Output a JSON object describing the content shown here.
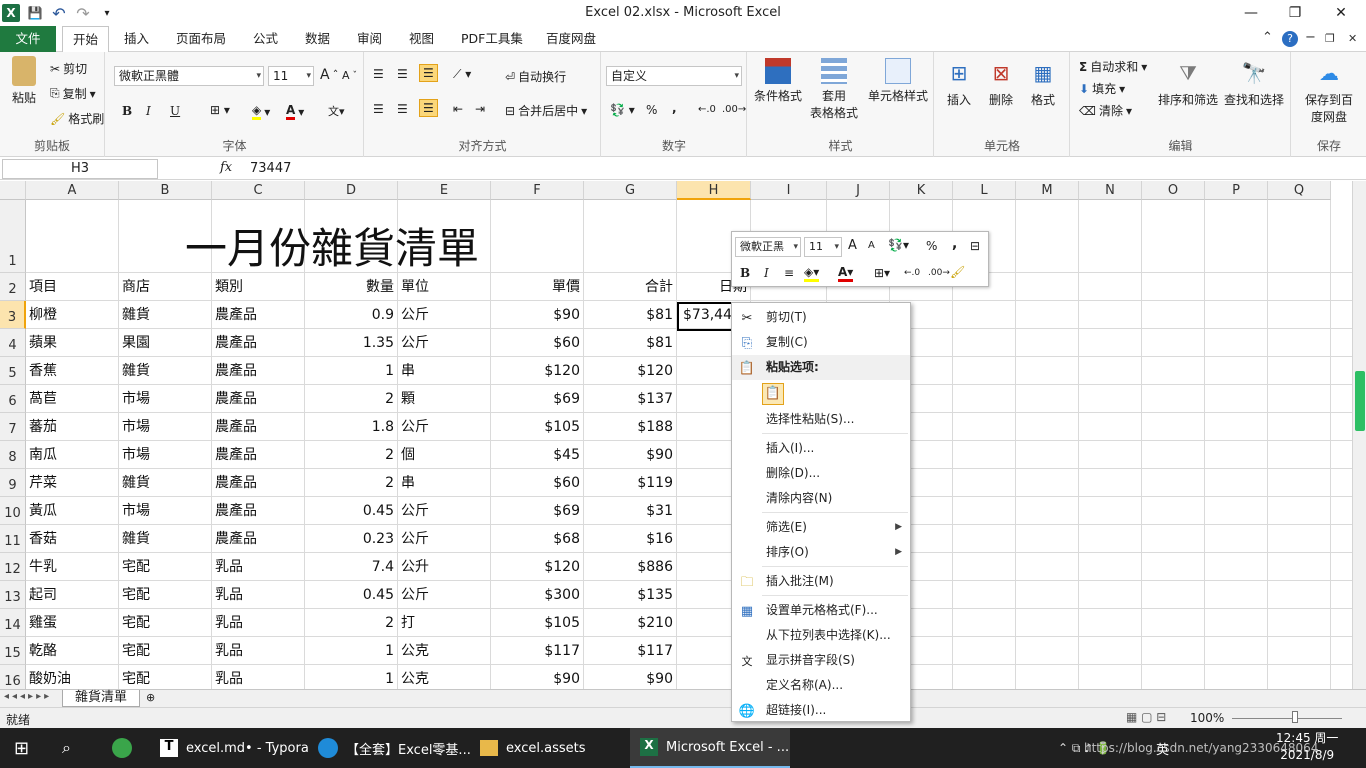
{
  "window": {
    "title": "Excel 02.xlsx  -  Microsoft Excel",
    "min": "—",
    "restore": "❐",
    "close": "✕"
  },
  "qat": {
    "logo": "X",
    "save": "💾",
    "undo": "↶",
    "redo": "↷",
    "custom": "▾"
  },
  "tabs": [
    "文件",
    "开始",
    "插入",
    "页面布局",
    "公式",
    "数据",
    "审阅",
    "视图",
    "PDF工具集",
    "百度网盘"
  ],
  "ribbon": {
    "clipboard": {
      "label": "剪贴板",
      "paste": "粘贴",
      "cut": "剪切",
      "copy": "复制",
      "painter": "格式刷"
    },
    "font": {
      "label": "字体",
      "name": "微軟正黑體",
      "size": "11",
      "bold": "B",
      "italic": "I",
      "underline": "U"
    },
    "align": {
      "label": "对齐方式",
      "wrap": "自动换行",
      "merge": "合并后居中"
    },
    "number": {
      "label": "数字",
      "format": "自定义",
      "percent": "%",
      "comma": ","
    },
    "styles": {
      "label": "样式",
      "cond": "条件格式",
      "table1": "套用",
      "table2": "表格格式",
      "cellstyle": "单元格样式"
    },
    "cells": {
      "label": "单元格",
      "insert": "插入",
      "delete": "删除",
      "format": "格式"
    },
    "edit": {
      "label": "编辑",
      "autosum": "自动求和",
      "fill": "填充",
      "clear": "清除",
      "sort": "排序和筛选",
      "find": "查找和选择"
    },
    "save": {
      "label": "保存",
      "btn1": "保存到百",
      "btn2": "度网盘"
    }
  },
  "formula": {
    "namebox": "H3",
    "fx": "fx",
    "value": "73447"
  },
  "columns": [
    "A",
    "B",
    "C",
    "D",
    "E",
    "F",
    "G",
    "H",
    "I",
    "J",
    "K",
    "L",
    "M",
    "N",
    "O",
    "P",
    "Q"
  ],
  "sheet_title": "一月份雜貨清單",
  "headers": {
    "a": "項目",
    "b": "商店",
    "c": "類別",
    "d": "數量",
    "e": "單位",
    "f": "單價",
    "g": "合計",
    "h": "日期"
  },
  "rows": [
    {
      "n": "3",
      "a": "柳橙",
      "b": "雜貨",
      "c": "農產品",
      "d": "0.9",
      "e": "公斤",
      "f": "$90",
      "g": "$81",
      "h": "$73,44"
    },
    {
      "n": "4",
      "a": "蘋果",
      "b": "果園",
      "c": "農產品",
      "d": "1.35",
      "e": "公斤",
      "f": "$60",
      "g": "$81",
      "h": ""
    },
    {
      "n": "5",
      "a": "香蕉",
      "b": "雜貨",
      "c": "農產品",
      "d": "1",
      "e": "串",
      "f": "$120",
      "g": "$120",
      "h": ""
    },
    {
      "n": "6",
      "a": "萵苣",
      "b": "市場",
      "c": "農產品",
      "d": "2",
      "e": "顆",
      "f": "$69",
      "g": "$137",
      "h": ""
    },
    {
      "n": "7",
      "a": "蕃茄",
      "b": "市場",
      "c": "農產品",
      "d": "1.8",
      "e": "公斤",
      "f": "$105",
      "g": "$188",
      "h": ""
    },
    {
      "n": "8",
      "a": "南瓜",
      "b": "市場",
      "c": "農產品",
      "d": "2",
      "e": "個",
      "f": "$45",
      "g": "$90",
      "h": ""
    },
    {
      "n": "9",
      "a": "芹菜",
      "b": "雜貨",
      "c": "農產品",
      "d": "2",
      "e": "串",
      "f": "$60",
      "g": "$119",
      "h": ""
    },
    {
      "n": "10",
      "a": "黃瓜",
      "b": "市場",
      "c": "農產品",
      "d": "0.45",
      "e": "公斤",
      "f": "$69",
      "g": "$31",
      "h": ""
    },
    {
      "n": "11",
      "a": "香菇",
      "b": "雜貨",
      "c": "農產品",
      "d": "0.23",
      "e": "公斤",
      "f": "$68",
      "g": "$16",
      "h": ""
    },
    {
      "n": "12",
      "a": "牛乳",
      "b": "宅配",
      "c": "乳品",
      "d": "7.4",
      "e": "公升",
      "f": "$120",
      "g": "$886",
      "h": ""
    },
    {
      "n": "13",
      "a": "起司",
      "b": "宅配",
      "c": "乳品",
      "d": "0.45",
      "e": "公斤",
      "f": "$300",
      "g": "$135",
      "h": ""
    },
    {
      "n": "14",
      "a": "雞蛋",
      "b": "宅配",
      "c": "乳品",
      "d": "2",
      "e": "打",
      "f": "$105",
      "g": "$210",
      "h": ""
    },
    {
      "n": "15",
      "a": "乾酪",
      "b": "宅配",
      "c": "乳品",
      "d": "1",
      "e": "公克",
      "f": "$117",
      "g": "$117",
      "h": ""
    },
    {
      "n": "16",
      "a": "酸奶油",
      "b": "宅配",
      "c": "乳品",
      "d": "1",
      "e": "公克",
      "f": "$90",
      "g": "$90",
      "h": ""
    }
  ],
  "row_labels": [
    "1",
    "2"
  ],
  "minitoolbar": {
    "font": "微軟正黑",
    "size": "11",
    "percent": "%",
    "comma": ",",
    "bold": "B",
    "italic": "I"
  },
  "context_menu": {
    "cut": "剪切(T)",
    "copy": "复制(C)",
    "paste_opts": "粘贴选项:",
    "paste_special": "选择性粘贴(S)...",
    "insert": "插入(I)...",
    "delete": "删除(D)...",
    "clear": "清除内容(N)",
    "filter": "筛选(E)",
    "sort": "排序(O)",
    "comment": "插入批注(M)",
    "format": "设置单元格格式(F)...",
    "dropdown": "从下拉列表中选择(K)...",
    "phonetic": "显示拼音字段(S)",
    "define": "定义名称(A)...",
    "hyperlink": "超链接(I)..."
  },
  "sheet_tab": "雜貨清單",
  "status": {
    "ready": "就绪",
    "zoom": "100%"
  },
  "taskbar": {
    "typora": "excel.md• - Typora",
    "edge": "【全套】Excel零基...",
    "folder": "excel.assets",
    "excel": "Microsoft Excel - ...",
    "time": "12:45 周一",
    "date": "2021/8/9",
    "watermark": "https://blog.csdn.net/yang2330648064",
    "lang": "英"
  }
}
